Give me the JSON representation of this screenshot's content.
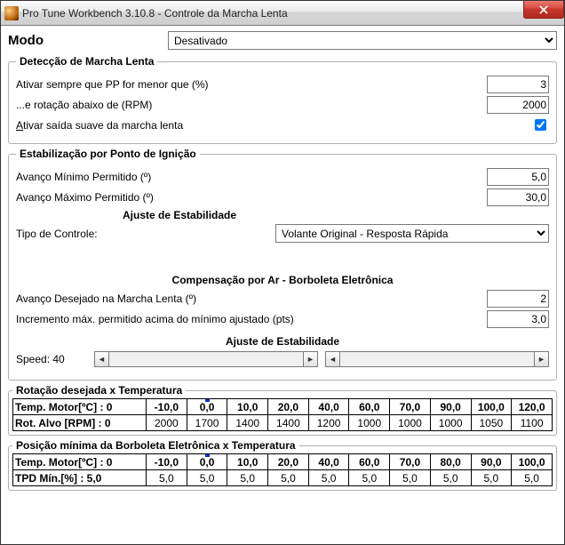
{
  "window": {
    "title": "Pro Tune Workbench 3.10.8  -  Controle da Marcha Lenta"
  },
  "mode": {
    "label": "Modo",
    "value": "Desativado"
  },
  "detect": {
    "legend": "Detecção de Marcha Lenta",
    "pp_label": "Ativar sempre que PP for menor que (%)",
    "pp_value": "3",
    "rpm_label": "...e rotação abaixo de (RPM)",
    "rpm_value": "2000",
    "soft_exit_key": "A",
    "soft_exit_rest": "tivar saída suave da marcha lenta",
    "soft_exit_checked": true
  },
  "spark": {
    "legend": "Estabilização por Ponto de Ignição",
    "adv_min_label": "Avanço Mínimo Permitido (º)",
    "adv_min_value": "5,0",
    "adv_max_label": "Avanço Máximo Permitido (º)",
    "adv_max_value": "30,0",
    "adjust_title": "Ajuste de Estabilidade",
    "ctrl_label": "Tipo de Controle:",
    "ctrl_value": "Volante Original - Resposta Rápida"
  },
  "air": {
    "title": "Compensação por Ar - Borboleta Eletrônica",
    "desired_adv_label": "Avanço Desejado na Marcha Lenta (º)",
    "desired_adv_value": "2",
    "max_inc_label": "Incremento máx. permitido acima do mínimo ajustado (pts)",
    "max_inc_value": "3,0",
    "adjust_title": "Ajuste de Estabilidade",
    "speed_label": "Speed: 40"
  },
  "table1": {
    "legend": "Rotação desejada  x Temperatura",
    "row1_label": "Temp. Motor[ºC] : 0",
    "row1": [
      "-10,0",
      "0,0",
      "10,0",
      "20,0",
      "40,0",
      "60,0",
      "70,0",
      "90,0",
      "100,0",
      "120,0"
    ],
    "row2_label": "Rot. Alvo [RPM] : 0",
    "row2": [
      "2000",
      "1700",
      "1400",
      "1400",
      "1200",
      "1000",
      "1000",
      "1000",
      "1050",
      "1100"
    ],
    "active_col": 1
  },
  "table2": {
    "legend": "Posição mínima da Borboleta Eletrônica x Temperatura",
    "row1_label": "Temp. Motor[ºC] : 0",
    "row1": [
      "-10,0",
      "0,0",
      "10,0",
      "20,0",
      "40,0",
      "60,0",
      "70,0",
      "80,0",
      "90,0",
      "100,0"
    ],
    "row2_label": "TPD Mín.[%] : 5,0",
    "row2": [
      "5,0",
      "5,0",
      "5,0",
      "5,0",
      "5,0",
      "5,0",
      "5,0",
      "5,0",
      "5,0",
      "5,0"
    ],
    "active_col": 1
  }
}
